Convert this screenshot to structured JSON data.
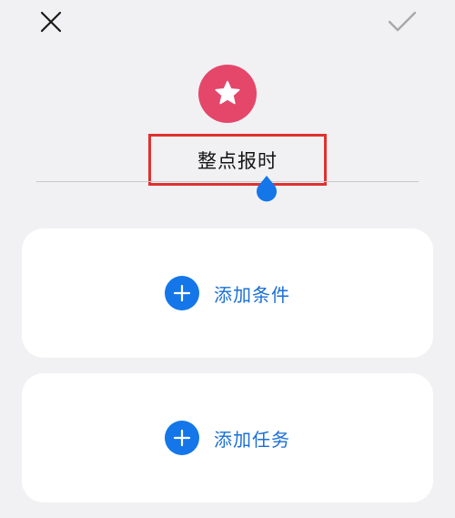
{
  "header": {
    "close_icon": "close-icon",
    "confirm_icon": "check-icon"
  },
  "scene": {
    "icon": "star-icon",
    "icon_color": "#e5476a",
    "name": "整点报时",
    "highlight_color": "#e0312f"
  },
  "cards": {
    "add_condition_label": "添加条件",
    "add_task_label": "添加任务",
    "accent_color": "#1476e8"
  }
}
